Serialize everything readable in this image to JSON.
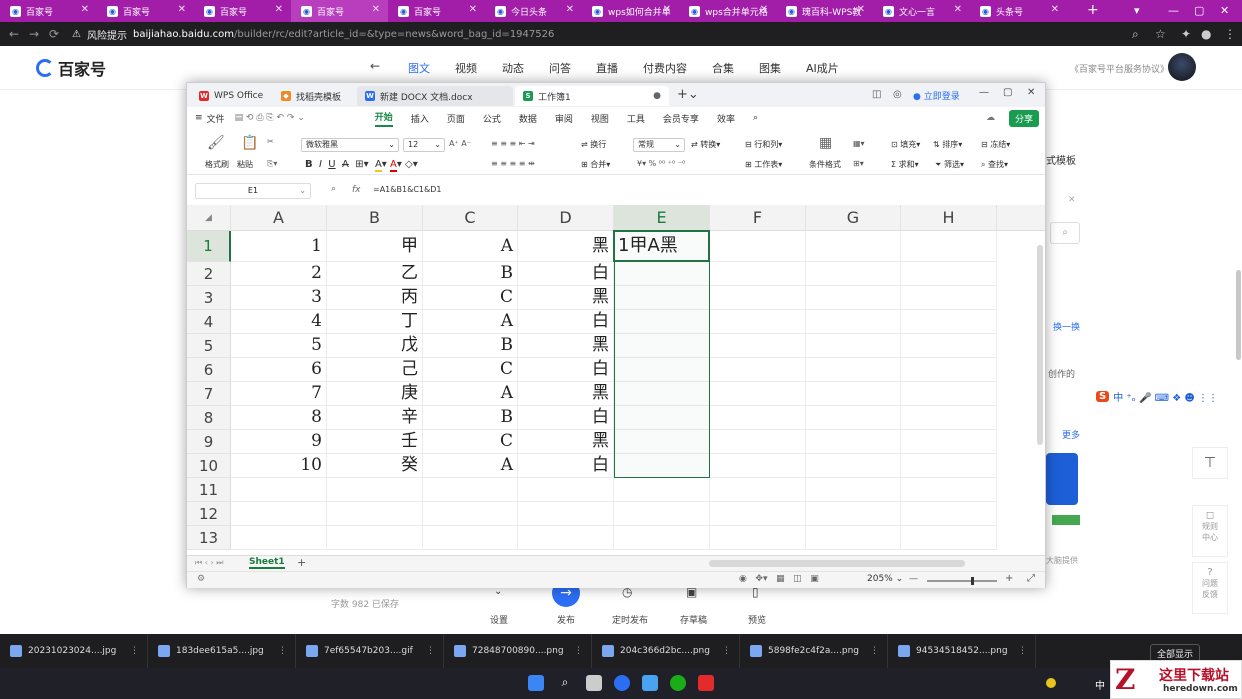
{
  "browser": {
    "tabs": [
      "百家号",
      "百家号",
      "百家号",
      "百家号",
      "百家号",
      "今日头条",
      "wps如何合并单",
      "wps合并单元格",
      "瑰百科-WPS教",
      "文心一言",
      "头条号"
    ],
    "url_warning": "风险提示",
    "url_host": "baijiahao.baidu.com",
    "url_path": "/builder/rc/edit?article_id=&type=news&word_bag_id=1947526"
  },
  "baijiahao": {
    "logo": "百家号",
    "nav": [
      "图文",
      "视频",
      "动态",
      "问答",
      "直播",
      "付费内容",
      "合集",
      "图集",
      "AI成片"
    ],
    "protocol": "《百家号平台服务协议》",
    "right_texts": {
      "template": "式模板",
      "swap": "换一换",
      "created": "创作的",
      "more": "更多",
      "rules": "规则中心",
      "issue": "问题反馈",
      "provided": "大脑提供"
    },
    "word_count": "字数 982  已保存",
    "bottom_tools": [
      "设置",
      "发布",
      "定时发布",
      "存草稿",
      "预览"
    ]
  },
  "wps": {
    "tabs": {
      "office": "WPS Office",
      "template": "找稻壳模板",
      "doc": "新建 DOCX 文档.docx",
      "sheet": "工作簿1"
    },
    "login": "立即登录",
    "menu": [
      "文件",
      "开始",
      "插入",
      "页面",
      "公式",
      "数据",
      "审阅",
      "视图",
      "工具",
      "会员专享",
      "效率"
    ],
    "share": "分享",
    "ribbon": {
      "format_painter": "格式刷",
      "paste": "粘贴",
      "font": "微软雅黑",
      "size": "12",
      "wrap": "换行",
      "merge": "合并",
      "number_format": "常规",
      "convert": "转换",
      "rows_cols": "行和列",
      "worksheet": "工作表",
      "cond_format": "条件格式",
      "fill": "填充",
      "sort": "排序",
      "freeze": "冻结",
      "sum": "求和",
      "filter": "筛选",
      "find": "查找"
    },
    "name_box": "E1",
    "formula": "=A1&B1&C1&D1",
    "columns": [
      "A",
      "B",
      "C",
      "D",
      "E",
      "F",
      "G",
      "H"
    ],
    "rows": [
      [
        "1",
        "甲",
        "A",
        "黑",
        "1甲A黑"
      ],
      [
        "2",
        "乙",
        "B",
        "白",
        ""
      ],
      [
        "3",
        "丙",
        "C",
        "黑",
        ""
      ],
      [
        "4",
        "丁",
        "A",
        "白",
        ""
      ],
      [
        "5",
        "戊",
        "B",
        "黑",
        ""
      ],
      [
        "6",
        "己",
        "C",
        "白",
        ""
      ],
      [
        "7",
        "庚",
        "A",
        "黑",
        ""
      ],
      [
        "8",
        "辛",
        "B",
        "白",
        ""
      ],
      [
        "9",
        "壬",
        "C",
        "黑",
        ""
      ],
      [
        "10",
        "癸",
        "A",
        "白",
        ""
      ]
    ],
    "row_numbers": [
      "1",
      "2",
      "3",
      "4",
      "5",
      "6",
      "7",
      "8",
      "9",
      "10",
      "11",
      "12",
      "13"
    ],
    "sheet_name": "Sheet1",
    "zoom": "205%"
  },
  "downloads": [
    "20231023024....jpg",
    "183dee615a5....jpg",
    "7ef65547b203....gif",
    "72848700890....png",
    "204c366d2bc....png",
    "5898fe2c4f2a....png",
    "94534518452....png"
  ],
  "show_all": "全部显示",
  "watermark": {
    "line1": "这里下载站",
    "line2": "heredown.com"
  }
}
